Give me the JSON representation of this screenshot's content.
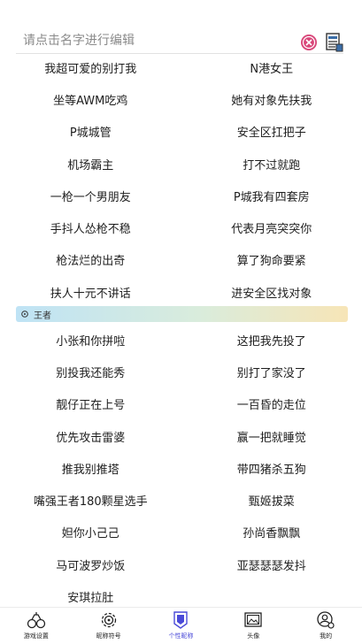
{
  "search": {
    "placeholder": "请点击名字进行编辑"
  },
  "icons": {
    "clear": "clear-icon",
    "doc": "document-icon"
  },
  "colors": {
    "accent": "#4a4ad8",
    "clear_pink": "#d9477a"
  },
  "section1": {
    "rows": [
      [
        "我超可爱的别打我",
        "N港女王"
      ],
      [
        "坐等AWM吃鸡",
        "她有对象先扶我"
      ],
      [
        "P城城管",
        "安全区扛把子"
      ],
      [
        "机场霸主",
        "打不过就跑"
      ],
      [
        "一枪一个男朋友",
        "P城我有四套房"
      ],
      [
        "手抖人怂枪不稳",
        "代表月亮突突你"
      ],
      [
        "枪法烂的出奇",
        "算了狗命要紧"
      ],
      [
        "扶人十元不讲话",
        "进安全区找对象"
      ]
    ]
  },
  "section2": {
    "title": "王者",
    "rows": [
      [
        "小张和你拼啦",
        "这把我先投了"
      ],
      [
        "别投我还能秀",
        "别打了家没了"
      ],
      [
        "靓仔正在上号",
        "一百昏的走位"
      ],
      [
        "优先攻击雷婆",
        "赢一把就睡觉"
      ],
      [
        "推我别推塔",
        "带四猪杀五狗"
      ],
      [
        "嘴强王者180颗星选手",
        "甄姬拔菜"
      ],
      [
        "妲你小己己",
        "孙尚香飘飘"
      ],
      [
        "马可波罗炒饭",
        "亚瑟瑟瑟发抖"
      ],
      [
        "安琪拉肚",
        ""
      ]
    ]
  },
  "tabs": [
    {
      "label": "游戏设置",
      "icon": "gamepad-icon",
      "active": false
    },
    {
      "label": "昵称符号",
      "icon": "gear-icon",
      "active": false
    },
    {
      "label": "个性昵称",
      "icon": "badge-icon",
      "active": true
    },
    {
      "label": "头像",
      "icon": "image-icon",
      "active": false
    },
    {
      "label": "我的",
      "icon": "user-icon",
      "active": false
    }
  ]
}
